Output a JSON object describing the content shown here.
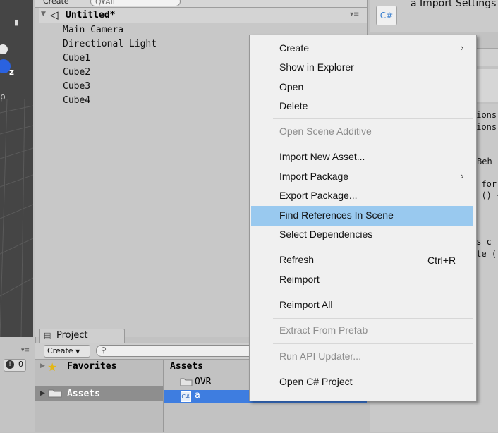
{
  "hierarchy": {
    "create_label": "Create",
    "search_placeholder": "Q▾All",
    "scene_title": "Untitled*",
    "items": [
      "Main Camera",
      "Directional Light",
      "Cube1",
      "Cube2",
      "Cube3",
      "Cube4"
    ]
  },
  "scene_view": {
    "axis_label": "z",
    "persp_label": "p"
  },
  "inspector": {
    "icon_text": "C#",
    "title": "a Import Settings",
    "code_lines": [
      "tions",
      "tions",
      "",
      "Beh",
      "",
      "s for",
      "t () {",
      "",
      "",
      "is c",
      "ate ()"
    ]
  },
  "project": {
    "tab_label": "Project",
    "create_label": "Create",
    "search_placeholder": "",
    "favorites_label": "Favorites",
    "assets_label": "Assets",
    "breadcrumb": "Assets",
    "items": [
      {
        "name": "OVR",
        "type": "folder"
      },
      {
        "name": "a",
        "type": "script",
        "selected": true
      }
    ]
  },
  "console": {
    "error_count": "0"
  },
  "context_menu": {
    "items": [
      {
        "label": "Create",
        "submenu": true,
        "enabled": true
      },
      {
        "label": "Show in Explorer",
        "enabled": true
      },
      {
        "label": "Open",
        "enabled": true
      },
      {
        "label": "Delete",
        "enabled": true
      },
      {
        "label": "Open Scene Additive",
        "enabled": false
      },
      {
        "label": "Import New Asset...",
        "enabled": true
      },
      {
        "label": "Import Package",
        "submenu": true,
        "enabled": true
      },
      {
        "label": "Export Package...",
        "enabled": true
      },
      {
        "label": "Find References In Scene",
        "enabled": true,
        "highlighted": true
      },
      {
        "label": "Select Dependencies",
        "enabled": true
      },
      {
        "label": "Refresh",
        "shortcut": "Ctrl+R",
        "enabled": true
      },
      {
        "label": "Reimport",
        "enabled": true
      },
      {
        "label": "Reimport All",
        "enabled": true
      },
      {
        "label": "Extract From Prefab",
        "enabled": false
      },
      {
        "label": "Run API Updater...",
        "enabled": false
      },
      {
        "label": "Open C# Project",
        "enabled": true
      }
    ]
  },
  "colors": {
    "highlight": "#99c9ef",
    "selection": "#3e7de0",
    "menu_bg": "#f0f0f0"
  }
}
